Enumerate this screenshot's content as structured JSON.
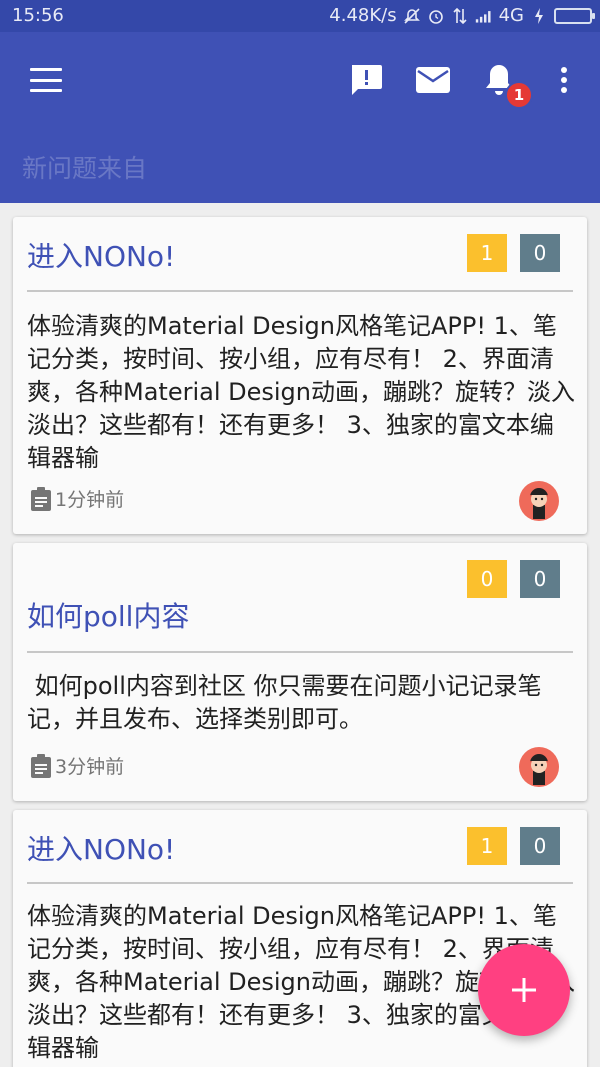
{
  "status_bar": {
    "time": "15:56",
    "network_speed": "4.48K/s",
    "network_type": "4G",
    "icons": [
      "mute-icon",
      "alarm-icon",
      "data-transfer-icon",
      "signal-icon",
      "charging-icon",
      "battery-icon"
    ]
  },
  "app_bar": {
    "search_placeholder": "新问题来自",
    "notification_badge": "1",
    "icons": [
      "menu-icon",
      "feedback-icon",
      "mail-icon",
      "bell-icon",
      "more-vert-icon"
    ],
    "background": "#3f51b5"
  },
  "cards": [
    {
      "title": "进入NONo!",
      "count_yellow": "1",
      "count_gray": "0",
      "body": "体验清爽的Material Design风格笔记APP! 1、笔记分类，按时间、按小组，应有尽有！ 2、界面清爽，各种Material Design动画，蹦跳？旋转？淡入淡出？这些都有！还有更多！ 3、独家的富文本编辑器输",
      "time": "1分钟前"
    },
    {
      "title": "如何poll内容",
      "count_yellow": "0",
      "count_gray": "0",
      "body": " 如何poll内容到社区 你只需要在问题小记记录笔记，并且发布、选择类别即可。",
      "time": "3分钟前"
    },
    {
      "title": "进入NONo!",
      "count_yellow": "1",
      "count_gray": "0",
      "body": "体验清爽的Material Design风格笔记APP! 1、笔记分类，按时间、按小组，应有尽有！ 2、界面清爽，各种Material Design动画，蹦跳？旋转？淡入淡出？这些都有！还有更多！ 3、独家的富文本编辑器输"
    }
  ],
  "fab": {
    "icon": "plus-icon",
    "color": "#ff4081"
  },
  "colors": {
    "accent_yellow": "#fbc02d",
    "accent_gray": "#607d8b",
    "title_blue": "#3f51b5"
  }
}
